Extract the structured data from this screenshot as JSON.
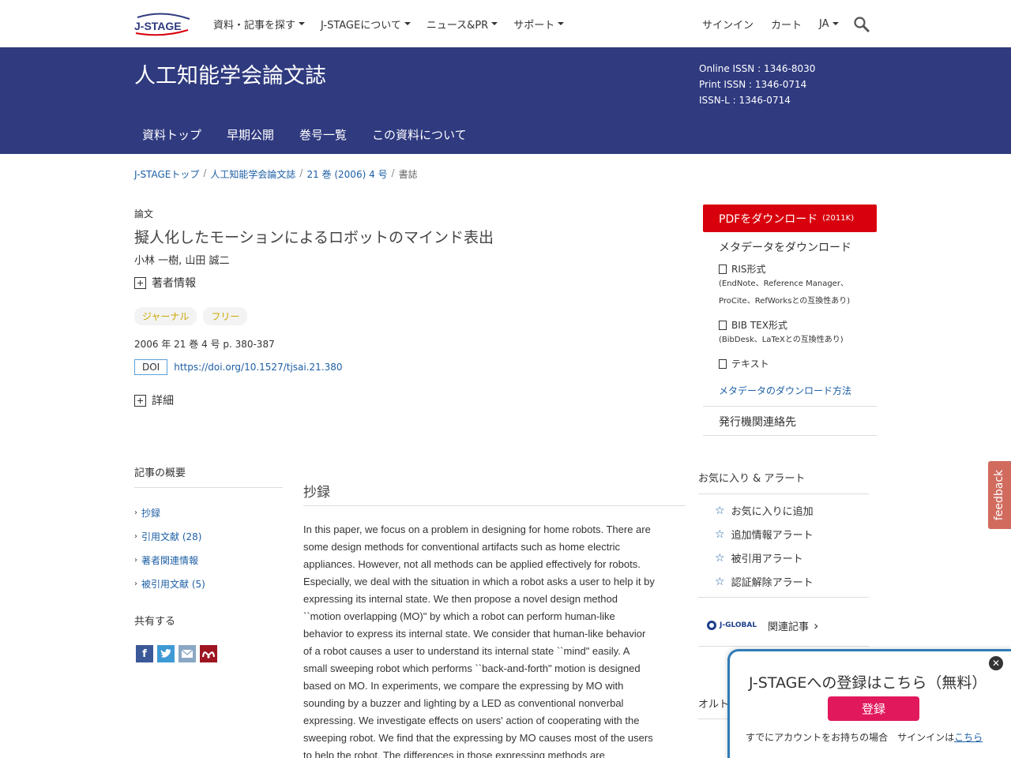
{
  "header": {
    "logo_text": "J-STAGE",
    "nav_left": [
      "資料・記事を探す",
      "J-STAGEについて",
      "ニュース&PR",
      "サポート"
    ],
    "nav_right": [
      "サインイン",
      "カート",
      "JA"
    ]
  },
  "banner": {
    "journal_title": "人工知能学会論文誌",
    "issn_online": "Online ISSN : 1346-8030",
    "issn_print": "Print ISSN : 1346-0714",
    "issn_l": "ISSN-L : 1346-0714",
    "tabs": [
      "資料トップ",
      "早期公開",
      "巻号一覧",
      "この資料について"
    ]
  },
  "breadcrumb": [
    "J-STAGEトップ",
    "人工知能学会論文誌",
    "21 巻 (2006) 4 号",
    "書誌"
  ],
  "article": {
    "type": "論文",
    "title": "擬人化したモーションによるロボットのマインド表出",
    "authors": "小林 一樹, 山田 誠二",
    "author_info": "著者情報",
    "tags": [
      "ジャーナル",
      "フリー"
    ],
    "citation": "2006 年 21 巻 4 号 p. 380-387",
    "doi_label": "DOI",
    "doi_url": "https://doi.org/10.1527/tjsai.21.380",
    "details": "詳細"
  },
  "download": {
    "pdf_label": "PDFをダウンロード",
    "pdf_size": "(2011K)",
    "meta_head": "メタデータをダウンロード",
    "ris": "RIS形式",
    "ris_note1": "(EndNote、Reference Manager、",
    "ris_note2": "ProCite、RefWorksとの互換性あり)",
    "bib": "BIB TEX形式",
    "bib_note": "(BibDesk、LaTeXとの互換性あり)",
    "text": "テキスト",
    "howto": "メタデータのダウンロード方法",
    "publisher": "発行機関連絡先"
  },
  "sidebar": {
    "overview_head": "記事の概要",
    "links": [
      "抄録",
      "引用文献 (28)",
      "著者関連情報",
      "被引用文献 (5)"
    ],
    "share_head": "共有する",
    "share_icons": [
      "facebook-icon",
      "twitter-icon",
      "mail-icon",
      "mendeley-icon"
    ]
  },
  "abstract": {
    "heading": "抄録",
    "lines": [
      "In this paper, we focus on a problem in designing for home robots. There are",
      "some design methods for conventional artifacts such as home electric",
      "appliances. However, not all methods can be applied effectively for robots.",
      "Especially, we deal with the situation in which a robot asks a user to help it by",
      "expressing its internal state. We then propose a novel design method",
      "``motion overlapping (MO)\" by which a robot can perform human-like",
      "behavior to express its internal state. We consider that human-like behavior",
      "of a robot causes a user to understand its internal state ``mind\" easily. A",
      "small sweeping robot which performs ``back-and-forth\" motion is designed",
      "based on MO. In experiments, we compare the expressing by MO with",
      "sounding by a buzzer and lighting by a LED as conventional nonverbal",
      "expressing. We investigate effects on users' action of cooperating with the",
      "sweeping robot. We find that the expressing by MO causes most of the users",
      "to help the robot. The differences in those expressing methods are"
    ]
  },
  "alerts": {
    "heading": "お気に入り & アラート",
    "items": [
      "お気に入りに追加",
      "追加情報アラート",
      "被引用アラート",
      "認証解除アラート"
    ],
    "jglobal_logo": "J-GLOBAL",
    "jglobal_label": "関連記事",
    "alt_head": "オルト"
  },
  "feedback": "feedback",
  "popup": {
    "title": "J-STAGEへの登録はこちら（無料）",
    "button": "登録",
    "note": "すでにアカウントをお持ちの場合　サインインは",
    "note_link": "こちら",
    "close": "✕"
  }
}
